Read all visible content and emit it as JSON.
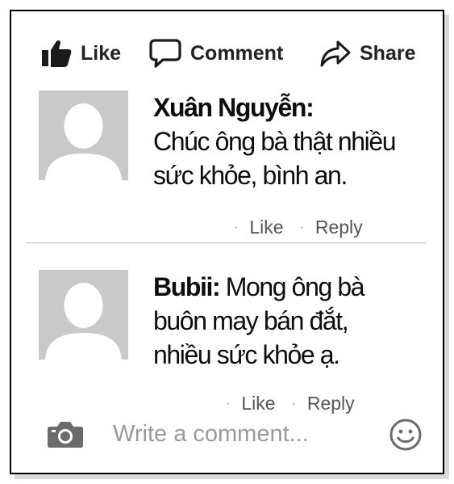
{
  "actions": {
    "like_label": "Like",
    "comment_label": "Comment",
    "share_label": "Share"
  },
  "comments": [
    {
      "author": "Xuân Nguyễn:",
      "text_line1": "Chúc ông bà thật nhiều",
      "text_line2": "sức khỏe, bình an.",
      "like_label": "Like",
      "reply_label": "Reply"
    },
    {
      "author": "Bubii:",
      "text_line1": " Mong ông bà",
      "text_line2": "buôn may bán đắt,",
      "text_line3": "nhiều sức khỏe ạ.",
      "like_label": "Like",
      "reply_label": "Reply"
    }
  ],
  "write_comment": {
    "placeholder": "Write a comment..."
  },
  "icons": {
    "like": "thumbs-up-icon",
    "comment": "speech-bubble-icon",
    "share": "share-arrow-icon",
    "camera": "camera-icon",
    "emoji": "smiley-icon"
  },
  "colors": {
    "text": "#111111",
    "muted": "#555555",
    "placeholder": "#9a9a9a",
    "avatar_bg": "#c9c9c9"
  }
}
